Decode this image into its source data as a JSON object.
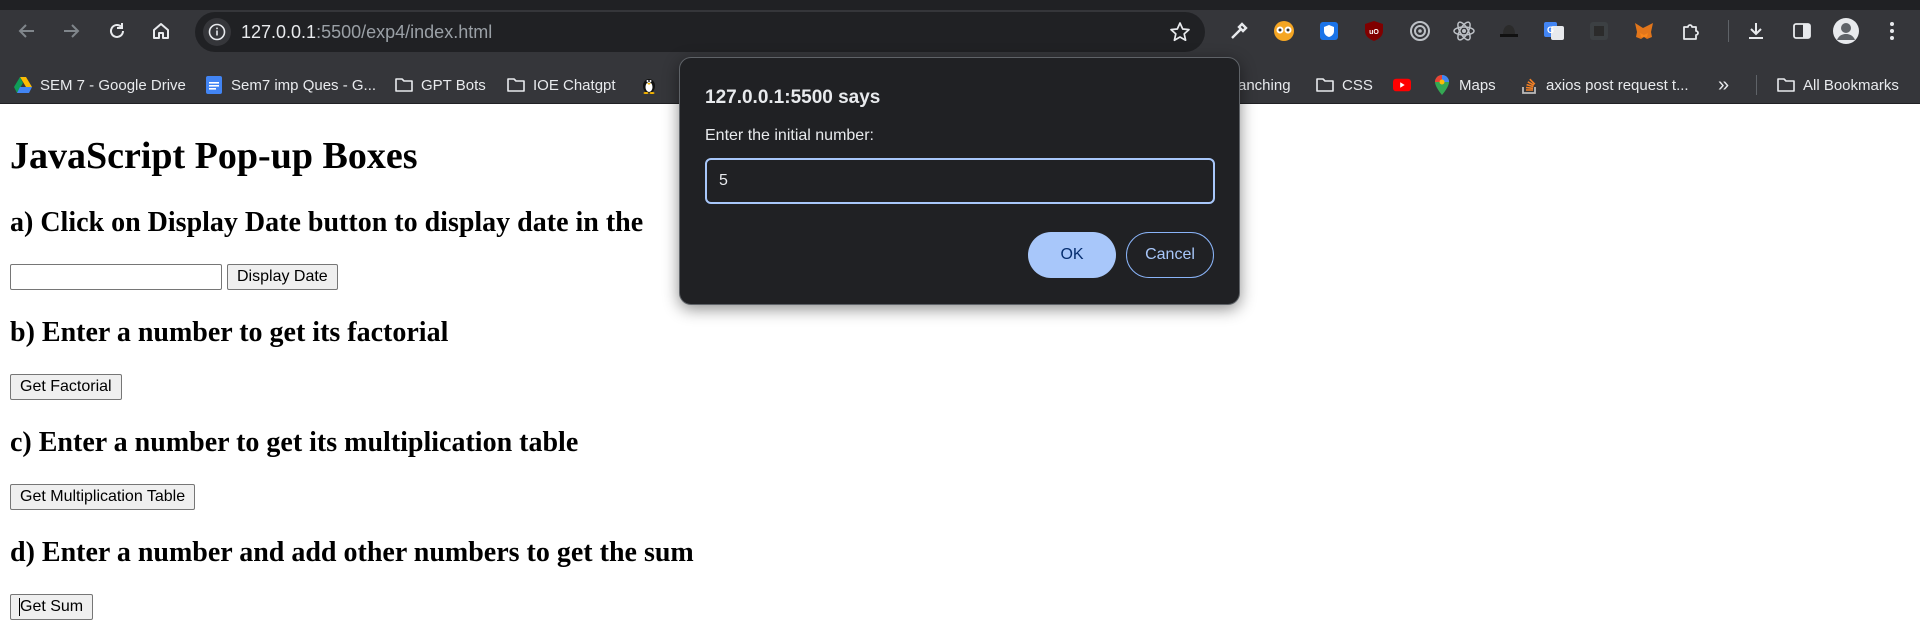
{
  "browser": {
    "url_host": "127.0.0.1",
    "url_path": ":5500/exp4/index.html",
    "nav": {
      "back_icon": "arrow-left-icon",
      "forward_icon": "arrow-right-icon",
      "reload_icon": "reload-icon",
      "home_icon": "home-icon"
    },
    "toolbar_icons": [
      "eyedropper-icon",
      "owl-extension-icon",
      "shield-extension-icon",
      "ublock-origin-icon",
      "target-extension-icon",
      "react-devtools-icon",
      "hat-extension-icon",
      "google-translate-icon",
      "dark-extension-icon",
      "metamask-icon",
      "extensions-puzzle-icon",
      "download-icon",
      "side-panel-icon",
      "profile-avatar-icon",
      "more-menu-icon"
    ]
  },
  "bookmarks": [
    {
      "label": "SEM 7 - Google Drive",
      "icon": "google-drive-icon"
    },
    {
      "label": "Sem7 imp Ques - G...",
      "icon": "google-docs-icon"
    },
    {
      "label": "GPT Bots",
      "icon": "folder-icon"
    },
    {
      "label": "IOE Chatgpt",
      "icon": "folder-icon"
    },
    {
      "label": "",
      "icon": "linux-penguin-icon"
    },
    {
      "label": "anching",
      "icon": ""
    },
    {
      "label": "CSS",
      "icon": "folder-icon"
    },
    {
      "label": "",
      "icon": "youtube-icon"
    },
    {
      "label": "Maps",
      "icon": "google-maps-icon"
    },
    {
      "label": "axios post request t...",
      "icon": "stackoverflow-icon"
    },
    {
      "label": "»",
      "icon": ""
    },
    {
      "label": "All Bookmarks",
      "icon": "folder-icon"
    }
  ],
  "page": {
    "title": "JavaScript Pop-up Boxes",
    "section_a": {
      "heading": "a) Click on Display Date button to display date in the",
      "input_value": "",
      "button": "Display Date"
    },
    "section_b": {
      "heading": "b) Enter a number to get its factorial",
      "button": "Get Factorial"
    },
    "section_c": {
      "heading": "c) Enter a number to get its multiplication table",
      "button": "Get Multiplication Table"
    },
    "section_d": {
      "heading": "d) Enter a number and add other numbers to get the sum",
      "button": "Get Sum"
    }
  },
  "dialog": {
    "title": "127.0.0.1:5500 says",
    "message": "Enter the initial number:",
    "input_value": "5",
    "ok_label": "OK",
    "cancel_label": "Cancel"
  },
  "colors": {
    "chrome_bg": "#35363a",
    "omnibox_bg": "#202124",
    "dialog_bg": "#202124",
    "dialog_accent": "#a8c7fa",
    "page_bg": "#ffffff"
  }
}
